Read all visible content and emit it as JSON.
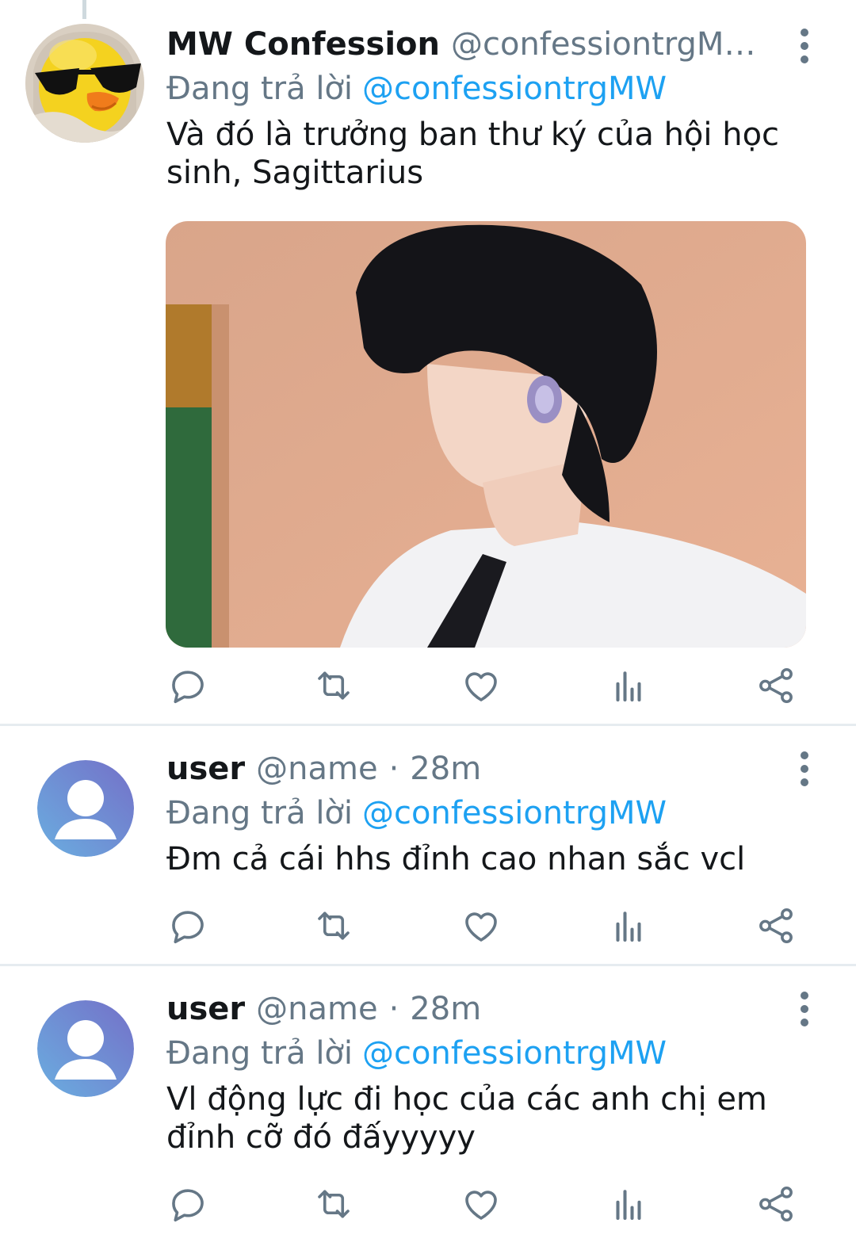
{
  "tweets": [
    {
      "name": "MW Confession",
      "handle": "@confessiontrgMW···",
      "replying_label": "Đang trả lời",
      "replying_to": "@confessiontrgMW",
      "text": "Và đó là trưởng ban thư ký của hội học sinh, Sagittarius",
      "avatar_icon": "duck-sunglasses-avatar",
      "has_media": true
    },
    {
      "name": "user",
      "handle": "@name",
      "separator": "·",
      "time": "28m",
      "replying_label": "Đang trả lời",
      "replying_to": "@confessiontrgMW",
      "text": "Đm cả cái hhs đỉnh cao nhan sắc vcl",
      "avatar_icon": "default-user-avatar"
    },
    {
      "name": "user",
      "handle": "@name",
      "separator": "·",
      "time": "28m",
      "replying_label": "Đang trả lời",
      "replying_to": "@confessiontrgMW",
      "text": "Vl động lực đi học của các anh chị em đỉnh cỡ đó đấyyyyy",
      "avatar_icon": "default-user-avatar"
    }
  ],
  "action_icons": [
    "reply-icon",
    "retweet-icon",
    "like-icon",
    "analytics-icon",
    "share-icon"
  ],
  "colors": {
    "accent": "#1da1f2",
    "text": "#14171a",
    "secondary": "#657786",
    "divider": "#e6ecf0"
  }
}
